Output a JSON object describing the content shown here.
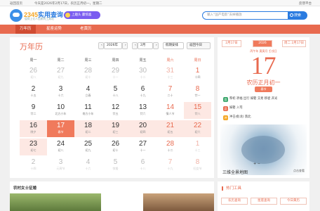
{
  "topbar": {
    "back": "返回首页",
    "notice": "今天是2026年2月17日，农历正月初一，星期二",
    "feedback": "反馈平台"
  },
  "header": {
    "brand_num": "2345",
    "brand_name": "实用查询",
    "slogan": "值得上亿人信赖的工具站",
    "promo": "上趣头 赢惊喜",
    "search_placeholder": "输入“国产电影”去掉播放",
    "search_button": "搜索"
  },
  "nav": {
    "items": [
      {
        "label": "万年历"
      },
      {
        "label": "星座运势"
      },
      {
        "label": "老黄历"
      }
    ]
  },
  "calendar": {
    "title": "万年历",
    "year_select": "2026年",
    "month_select": "2月",
    "holiday_select": "假期安排",
    "today_button": "返回今日",
    "prev_arrow": "‹",
    "next_arrow": "›",
    "weekdays": [
      "周一",
      "周二",
      "周三",
      "周四",
      "周五",
      "周六",
      "周日"
    ],
    "weeks": [
      [
        {
          "d": "26",
          "n": "初八",
          "dim": true
        },
        {
          "d": "27",
          "n": "初九",
          "dim": true
        },
        {
          "d": "28",
          "n": "初十",
          "dim": true
        },
        {
          "d": "29",
          "n": "十一",
          "dim": true
        },
        {
          "d": "30",
          "n": "十二",
          "dim": true
        },
        {
          "d": "31",
          "n": "十三",
          "dim": true
        },
        {
          "d": "1",
          "n": "十四"
        }
      ],
      [
        {
          "d": "2",
          "n": "十五"
        },
        {
          "d": "3",
          "n": "十六"
        },
        {
          "d": "4",
          "n": "立春"
        },
        {
          "d": "5",
          "n": "十八"
        },
        {
          "d": "6",
          "n": "十九"
        },
        {
          "d": "7",
          "n": "二十"
        },
        {
          "d": "8",
          "n": "廿一"
        }
      ],
      [
        {
          "d": "9",
          "n": "廿二"
        },
        {
          "d": "10",
          "n": "北方小年"
        },
        {
          "d": "11",
          "n": "南方小年"
        },
        {
          "d": "12",
          "n": "廿五"
        },
        {
          "d": "13",
          "n": "廿六"
        },
        {
          "d": "14",
          "n": "情人节"
        },
        {
          "d": "15",
          "n": "廿八"
        }
      ],
      [
        {
          "d": "16",
          "n": "除夕"
        },
        {
          "d": "17",
          "n": "春节"
        },
        {
          "d": "18",
          "n": "初二"
        },
        {
          "d": "19",
          "n": "初三"
        },
        {
          "d": "20",
          "n": "初四"
        },
        {
          "d": "21",
          "n": "初五"
        },
        {
          "d": "22",
          "n": "初六"
        }
      ],
      [
        {
          "d": "23",
          "n": "初七"
        },
        {
          "d": "24",
          "n": "初八"
        },
        {
          "d": "25",
          "n": "初九"
        },
        {
          "d": "26",
          "n": "初十"
        },
        {
          "d": "27",
          "n": "十一"
        },
        {
          "d": "28",
          "n": "十二"
        },
        {
          "d": "1",
          "n": "十三",
          "dim": true
        }
      ],
      [
        {
          "d": "2",
          "n": "十四",
          "dim": true
        },
        {
          "d": "3",
          "n": "元宵节",
          "dim": true
        },
        {
          "d": "4",
          "n": "十六",
          "dim": true
        },
        {
          "d": "5",
          "n": "惊蛰",
          "dim": true
        },
        {
          "d": "6",
          "n": "十八",
          "dim": true
        },
        {
          "d": "7",
          "n": "十九",
          "dim": true
        },
        {
          "d": "8",
          "n": "妇女节",
          "dim": true
        }
      ]
    ]
  },
  "day_panel": {
    "prev": "2月17日",
    "current": "2026",
    "next": "周二 2月17日",
    "ganzhi": "丙午年 庚寅月 壬戌日",
    "big_day": "17",
    "lunar_date": "农历正月初一",
    "festival": "春节",
    "yi_label": "宜",
    "yi": "祭祀 祈福 出行 嫁娶 交易 移徙 开光",
    "ji_label": "忌",
    "ji": "嫁娶 入宅",
    "chong_label": "冲",
    "chong": "冲壬戌(龙) 煞北",
    "map_caption": "三维全景地图",
    "map_more": "点击查看",
    "map_zoom": "+ −"
  },
  "bottom": {
    "title": "农村女士征婚"
  },
  "tools": {
    "title": "热门工具",
    "buttons": [
      "农历查询",
      "星座查询",
      "今日黄历"
    ]
  },
  "colors": {
    "accent": "#e86a4f",
    "brand": "#2a7be0"
  }
}
